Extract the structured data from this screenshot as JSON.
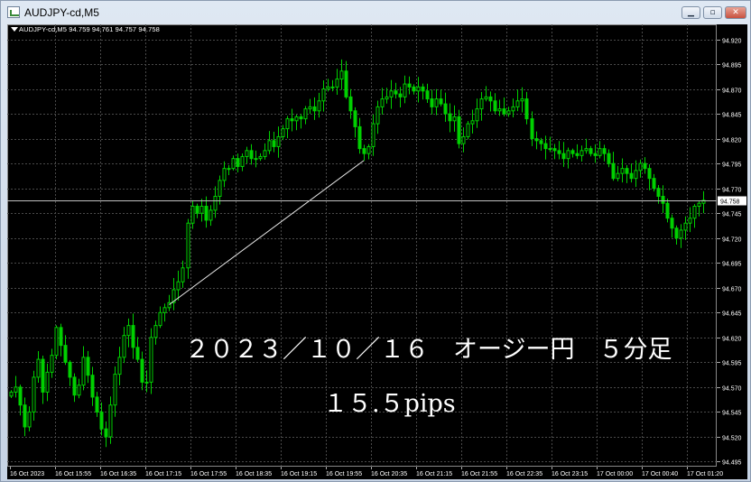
{
  "window": {
    "title": "AUDJPY-cd,M5",
    "minimize_glyph": "▁",
    "maximize_glyph": "▫",
    "close_glyph": "✕"
  },
  "chart": {
    "info_label": "AUDJPY-cd,M5  94.759 94.761 94.757 94.758",
    "annotation_title": "２０２３／１０／１６　オージー円　５分足",
    "annotation_pips": "１５.５pips"
  },
  "colors": {
    "background": "#000000",
    "grid": "#4a4a4a",
    "candle": "#00d000",
    "bid_line": "#c0c0c0",
    "price_tag_bg": "#ffffff",
    "price_tag_text": "#000000",
    "axis_text": "#ffffff",
    "trendline": "#e8e8e8"
  },
  "chart_data": {
    "type": "candlestick",
    "symbol": "AUDJPY-cd",
    "timeframe": "M5",
    "ylim": [
      94.49,
      94.935
    ],
    "y_ticks": [
      "94.920",
      "94.895",
      "94.870",
      "94.845",
      "94.820",
      "94.795",
      "94.770",
      "94.745",
      "94.720",
      "94.695",
      "94.670",
      "94.645",
      "94.620",
      "94.595",
      "94.570",
      "94.545",
      "94.520",
      "94.495"
    ],
    "x_ticks": [
      "16 Oct 2023",
      "16 Oct 15:55",
      "16 Oct 16:35",
      "16 Oct 17:15",
      "16 Oct 17:55",
      "16 Oct 18:35",
      "16 Oct 19:15",
      "16 Oct 19:55",
      "16 Oct 20:35",
      "16 Oct 21:15",
      "16 Oct 21:55",
      "16 Oct 22:35",
      "16 Oct 23:15",
      "17 Oct 00:00",
      "17 Oct 00:40",
      "17 Oct 01:20"
    ],
    "bid": 94.758,
    "bid_label": "94.758",
    "grid": true,
    "trendline": {
      "from": [
        35,
        94.653
      ],
      "to": [
        78,
        94.798
      ]
    },
    "closes": [
      94.565,
      94.57,
      94.552,
      94.53,
      94.545,
      94.58,
      94.598,
      94.565,
      94.585,
      94.602,
      94.63,
      94.612,
      94.595,
      94.58,
      94.562,
      94.572,
      94.6,
      94.582,
      94.56,
      94.545,
      94.528,
      94.52,
      94.552,
      94.583,
      94.6,
      94.622,
      94.632,
      94.61,
      94.598,
      94.575,
      94.575,
      94.62,
      94.632,
      94.645,
      94.65,
      94.655,
      94.668,
      94.676,
      94.69,
      94.735,
      94.752,
      94.745,
      94.752,
      94.738,
      94.748,
      94.762,
      94.778,
      94.79,
      94.79,
      94.8,
      94.792,
      94.802,
      94.808,
      94.8,
      94.8,
      94.802,
      94.808,
      94.818,
      94.812,
      94.822,
      94.83,
      94.84,
      94.838,
      94.842,
      94.84,
      94.85,
      94.852,
      94.848,
      94.858,
      94.87,
      94.872,
      94.872,
      94.88,
      94.888,
      94.862,
      94.848,
      94.832,
      94.81,
      94.805,
      94.812,
      94.835,
      94.852,
      94.86,
      94.862,
      94.868,
      94.865,
      94.862,
      94.875,
      94.872,
      94.868,
      94.872,
      94.868,
      94.86,
      94.852,
      94.86,
      94.855,
      94.845,
      94.838,
      94.842,
      94.815,
      94.822,
      94.835,
      94.838,
      94.85,
      94.86,
      94.862,
      94.858,
      94.848,
      94.85,
      94.845,
      94.848,
      94.852,
      94.858,
      94.86,
      94.84,
      94.82,
      94.818,
      94.815,
      94.81,
      94.81,
      94.808,
      94.805,
      94.8,
      94.808,
      94.805,
      94.803,
      94.808,
      94.81,
      94.805,
      94.803,
      94.81,
      94.805,
      94.795,
      94.78,
      94.785,
      94.79,
      94.785,
      94.78,
      94.788,
      94.795,
      94.79,
      94.78,
      94.77,
      94.762,
      94.755,
      94.74,
      94.73,
      94.72,
      94.728,
      94.735,
      94.74,
      94.752,
      94.755,
      94.758
    ]
  }
}
